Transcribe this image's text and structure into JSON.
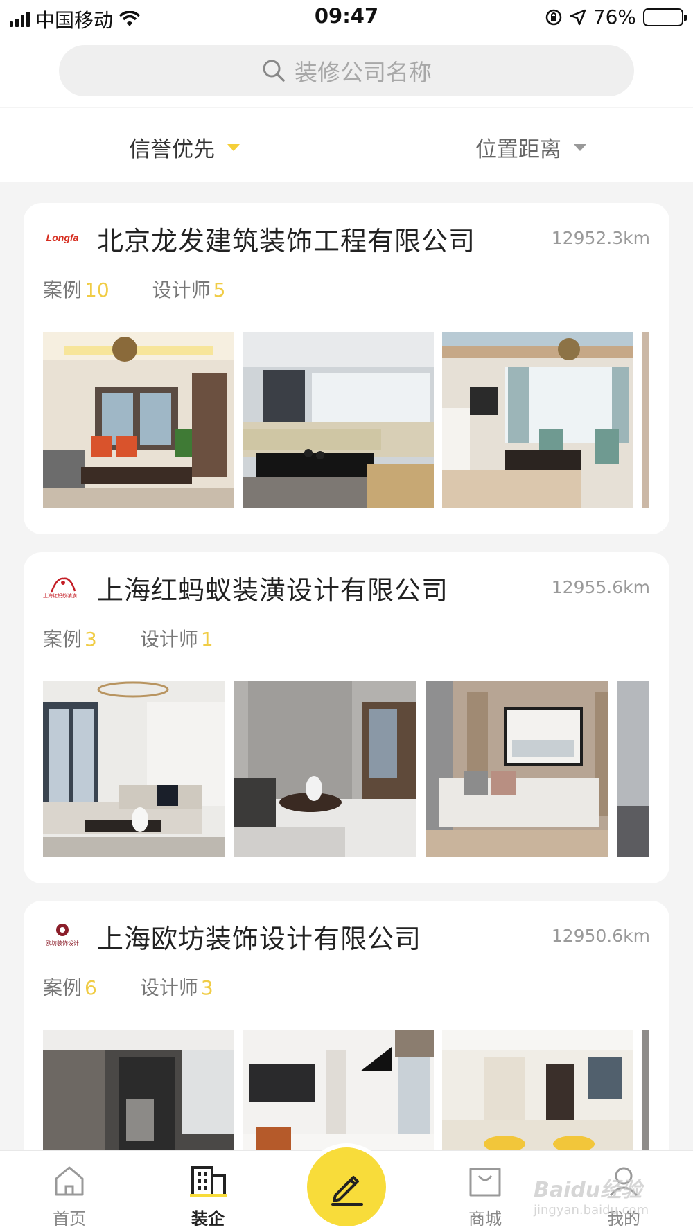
{
  "status_bar": {
    "carrier": "中国移动",
    "time": "09:47",
    "battery": "76%",
    "battery_level": 0.76
  },
  "search": {
    "placeholder": "装修公司名称"
  },
  "sort": {
    "credit": "信誉优先",
    "distance": "位置距离"
  },
  "companies": [
    {
      "name": "北京龙发建筑装饰工程有限公司",
      "logo_text": "Longfa",
      "logo_color": "#d62e20",
      "distance": "12952.3km",
      "cases_label": "案例",
      "cases": "10",
      "designers_label": "设计师",
      "designers": "5"
    },
    {
      "name": "上海红蚂蚁装潢设计有限公司",
      "logo_text": "上海红蚂蚁装潢",
      "logo_color": "#c41d25",
      "distance": "12955.6km",
      "cases_label": "案例",
      "cases": "3",
      "designers_label": "设计师",
      "designers": "1"
    },
    {
      "name": "上海欧坊装饰设计有限公司",
      "logo_text": "欧坊装饰设计",
      "logo_color": "#8b1e2a",
      "distance": "12950.6km",
      "cases_label": "案例",
      "cases": "6",
      "designers_label": "设计师",
      "designers": "3"
    }
  ],
  "tabs": {
    "home": "首页",
    "companies": "装企",
    "mall": "商城",
    "mine": "我的"
  },
  "watermark": {
    "brand": "Baidu经验",
    "url": "jingyan.baidu.com"
  },
  "colors": {
    "accent": "#f8dc3a",
    "highlight_number": "#f0cc45"
  }
}
